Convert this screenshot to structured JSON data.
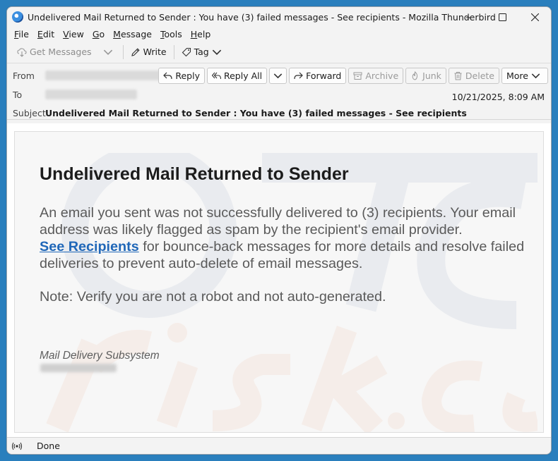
{
  "window": {
    "title": "Undelivered Mail Returned to Sender : You have (3) failed messages - See recipients - Mozilla Thunderbird",
    "controls": [
      "minimize",
      "maximize",
      "close"
    ]
  },
  "menu": {
    "items": [
      {
        "label": "File",
        "key": "F",
        "rest": "ile"
      },
      {
        "label": "Edit",
        "key": "E",
        "rest": "dit"
      },
      {
        "label": "View",
        "key": "V",
        "rest": "iew"
      },
      {
        "label": "Go",
        "key": "G",
        "rest": "o"
      },
      {
        "label": "Message",
        "key": "M",
        "rest": "essage"
      },
      {
        "label": "Tools",
        "key": "T",
        "rest": "ools"
      },
      {
        "label": "Help",
        "key": "H",
        "rest": "elp"
      }
    ]
  },
  "toolbar": {
    "get_messages": "Get Messages",
    "write": "Write",
    "tag": "Tag"
  },
  "header": {
    "from_label": "From",
    "to_label": "To",
    "subject_label": "Subject",
    "subject": "Undelivered Mail Returned to Sender : You have (3) failed messages - See recipients",
    "date": "10/21/2025, 8:09 AM",
    "actions": {
      "reply": "Reply",
      "reply_all": "Reply All",
      "forward": "Forward",
      "archive": "Archive",
      "junk": "Junk",
      "delete": "Delete",
      "more": "More"
    }
  },
  "message": {
    "heading": "Undelivered Mail Returned to Sender",
    "para_before": "An email you sent was not successfully delivered to (3) recipients. Your email address was likely flagged as spam by the recipient's email provider.",
    "link_text": "See Recipients",
    "para_after": " for bounce-back messages for more details and resolve failed deliveries to prevent auto-delete of email messages.",
    "note": "Note: Verify you are not a robot and not auto-generated.",
    "signature": "Mail Delivery Subsystem"
  },
  "status": {
    "text": "Done"
  },
  "colors": {
    "desktop": "#2a7fbd",
    "link": "#2067b8",
    "body_text": "#5a5a5a"
  }
}
